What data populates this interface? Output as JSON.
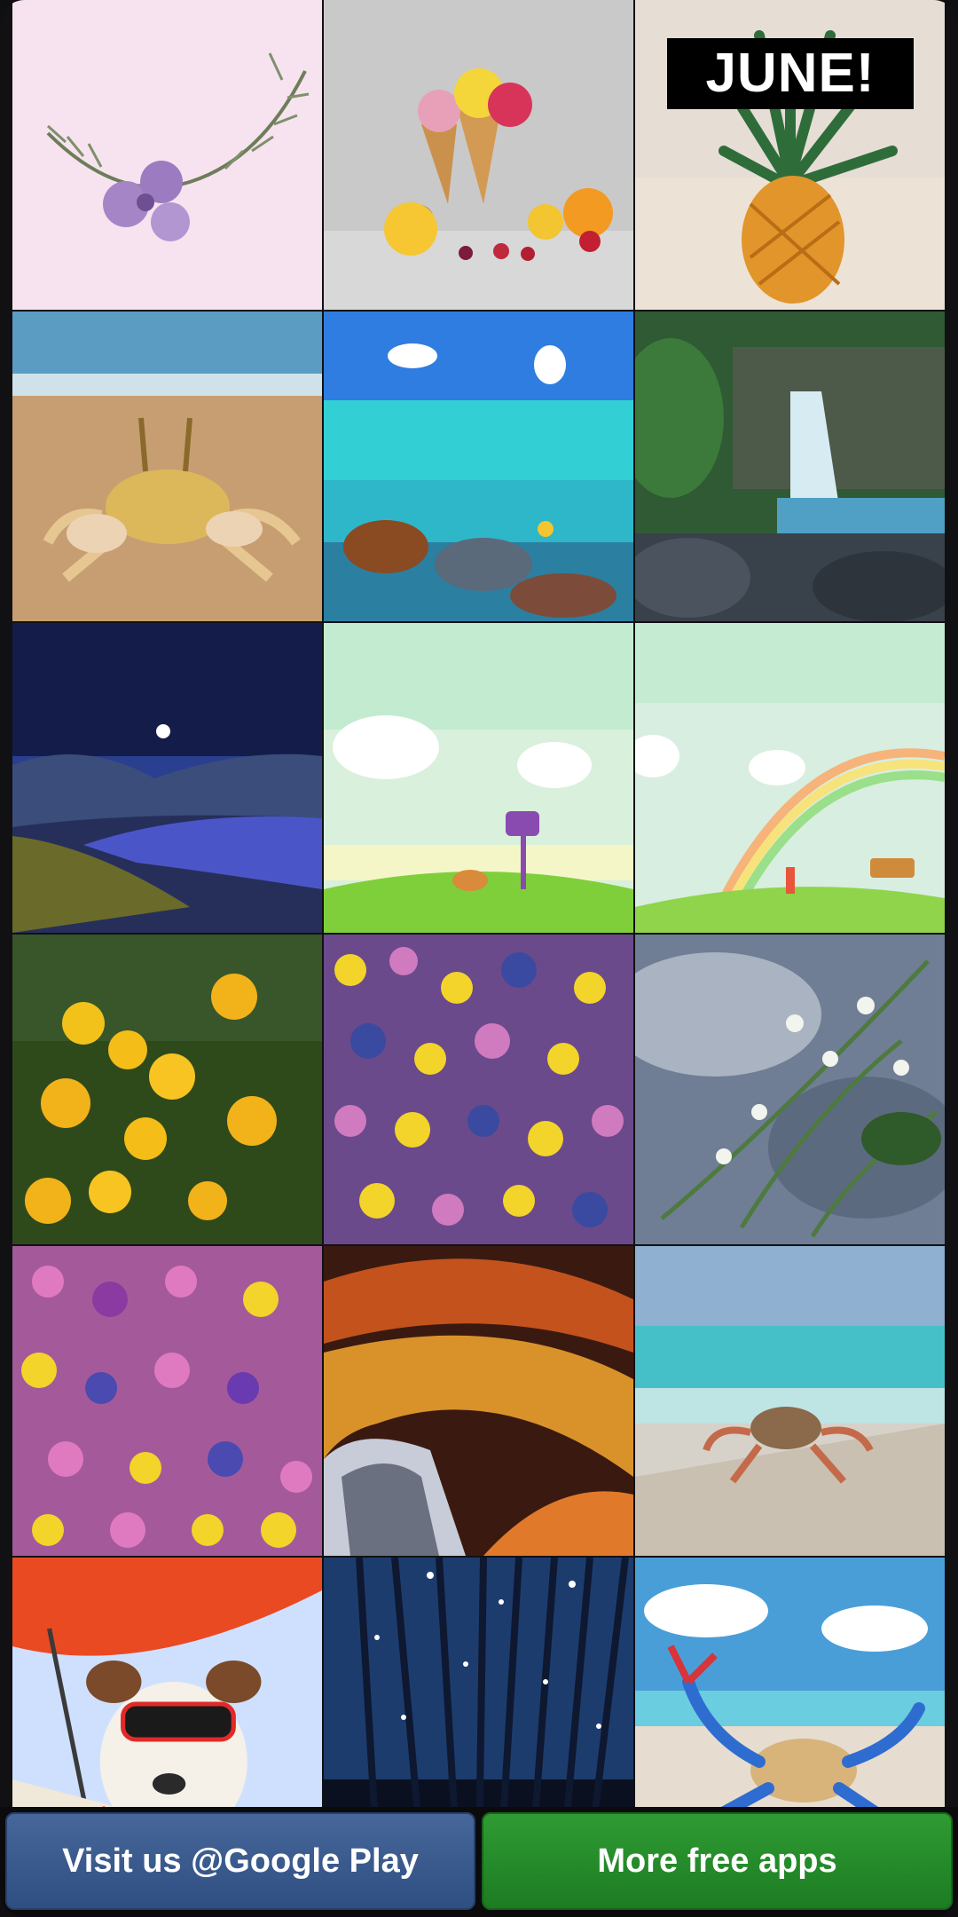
{
  "banner": {
    "june_text": "JUNE!"
  },
  "wallpapers": [
    {
      "name": "lavender-flowers-wallpaper"
    },
    {
      "name": "ice-cream-cones-wallpaper"
    },
    {
      "name": "pineapple-june-wallpaper"
    },
    {
      "name": "beach-crab-wallpaper"
    },
    {
      "name": "sea-turtle-lagoon-wallpaper"
    },
    {
      "name": "waterfall-rocks-wallpaper"
    },
    {
      "name": "night-moon-valley-wallpaper"
    },
    {
      "name": "cartoon-meadow-mailbox-wallpaper"
    },
    {
      "name": "cartoon-rainbow-meadow-wallpaper"
    },
    {
      "name": "yellow-daisies-wallpaper"
    },
    {
      "name": "wildflower-field-wallpaper"
    },
    {
      "name": "white-blossom-branch-wallpaper"
    },
    {
      "name": "flower-meadow-wallpaper"
    },
    {
      "name": "abstract-swirl-wallpaper"
    },
    {
      "name": "crab-on-driftwood-wallpaper"
    },
    {
      "name": "dog-under-umbrella-wallpaper"
    },
    {
      "name": "starry-forest-wallpaper"
    },
    {
      "name": "blue-crab-beach-wallpaper"
    }
  ],
  "footer": {
    "play_label": "Visit us @Google Play",
    "apps_label": "More free apps"
  },
  "colors": {
    "play_button": "#3b5a8d",
    "apps_button": "#238a28"
  }
}
